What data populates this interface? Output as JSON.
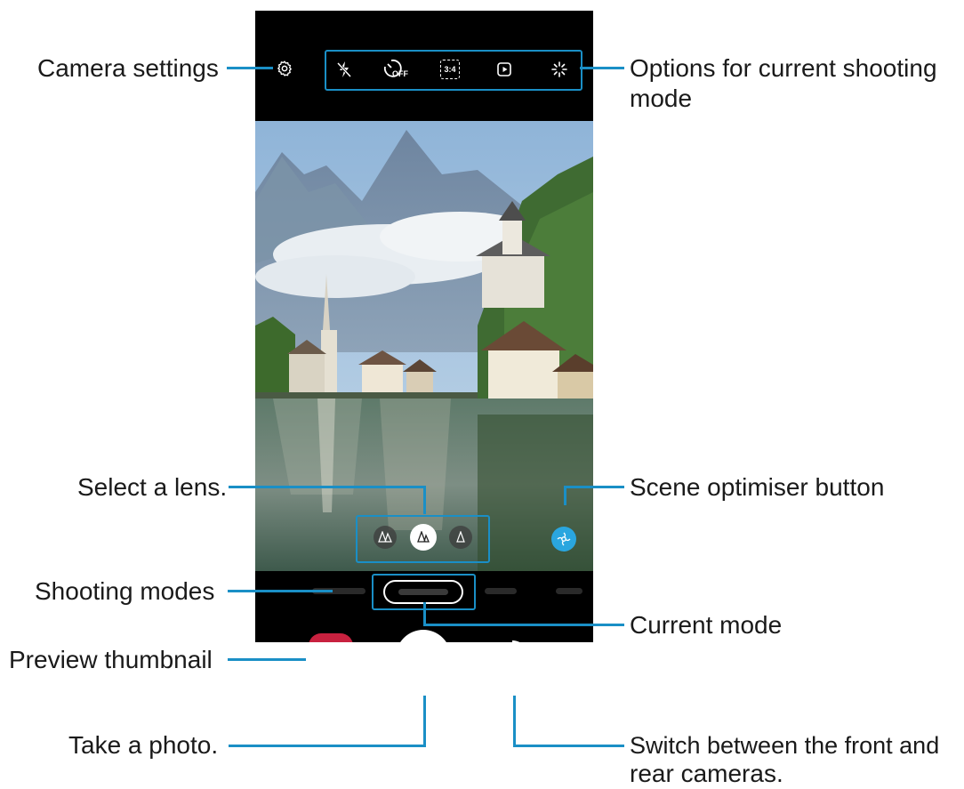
{
  "callouts": {
    "camera_settings": "Camera settings",
    "options_line1": "Options for current shooting",
    "options_line2": "mode",
    "select_lens": "Select a lens.",
    "scene_optimiser": "Scene optimiser button",
    "shooting_modes": "Shooting modes",
    "current_mode": "Current mode",
    "preview_thumbnail": "Preview thumbnail",
    "take_photo": "Take a photo.",
    "switch_line1": "Switch between the front and",
    "switch_line2": "rear cameras."
  },
  "top_options": {
    "timer_badge": "OFF",
    "ratio": "3:4"
  },
  "icons": {
    "settings": "gear-icon",
    "flash": "flash-off-icon",
    "timer": "timer-off-icon",
    "ratio": "aspect-ratio-icon",
    "motion": "motion-photo-icon",
    "filter": "filter-sparkle-icon",
    "lens_ultrawide": "lens-ultrawide-icon",
    "lens_wide": "lens-wide-icon",
    "lens_tele": "lens-tele-icon",
    "scene_optimiser": "scene-optimiser-icon",
    "gallery": "gallery-flower-icon",
    "shutter": "shutter-icon",
    "switch_camera": "switch-camera-icon"
  },
  "colors": {
    "accent": "#1a8fc6",
    "gallery": "#c8213f",
    "scene_optimiser": "#2aa6df"
  }
}
